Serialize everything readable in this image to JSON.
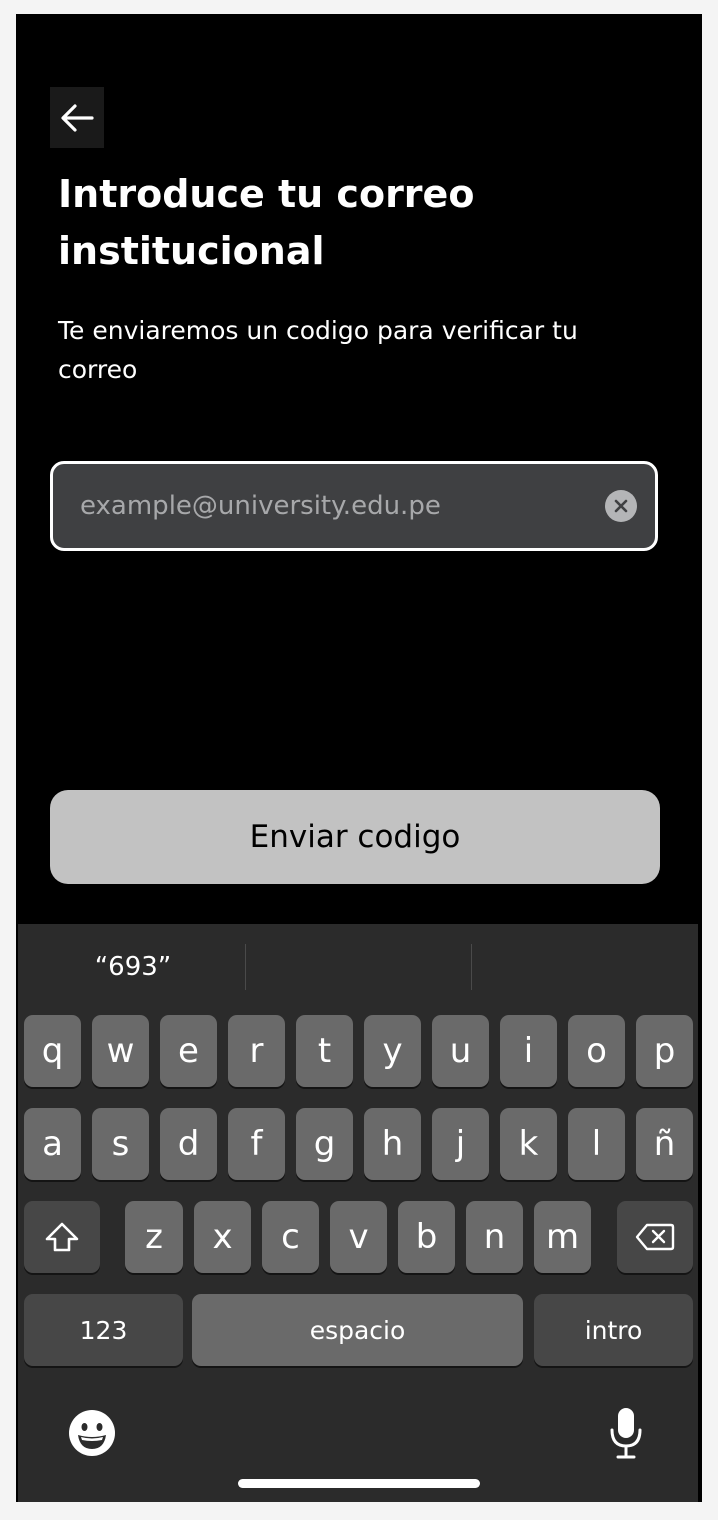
{
  "header": {
    "title": "Introduce tu correo institucional",
    "subtitle": "Te enviaremos un codigo para verificar tu correo"
  },
  "email": {
    "placeholder": "example@university.edu.pe",
    "value": ""
  },
  "actions": {
    "send_label": "Enviar codigo"
  },
  "keyboard": {
    "suggestions": [
      "“693”",
      "",
      ""
    ],
    "row1": [
      "q",
      "w",
      "e",
      "r",
      "t",
      "y",
      "u",
      "i",
      "o",
      "p"
    ],
    "row2": [
      "a",
      "s",
      "d",
      "f",
      "g",
      "h",
      "j",
      "k",
      "l",
      "ñ"
    ],
    "row3": [
      "z",
      "x",
      "c",
      "v",
      "b",
      "n",
      "m"
    ],
    "numbers_label": "123",
    "space_label": "espacio",
    "return_label": "intro",
    "icons": {
      "shift": "shift-icon",
      "backspace": "backspace-icon",
      "emoji": "emoji-icon",
      "mic": "microphone-icon"
    }
  },
  "colors": {
    "background": "#000000",
    "field": "#3f4042",
    "button": "#c2c2c2",
    "keyboard": "#2b2b2b",
    "key": "#6a6a6a",
    "key_dark": "#474747"
  }
}
